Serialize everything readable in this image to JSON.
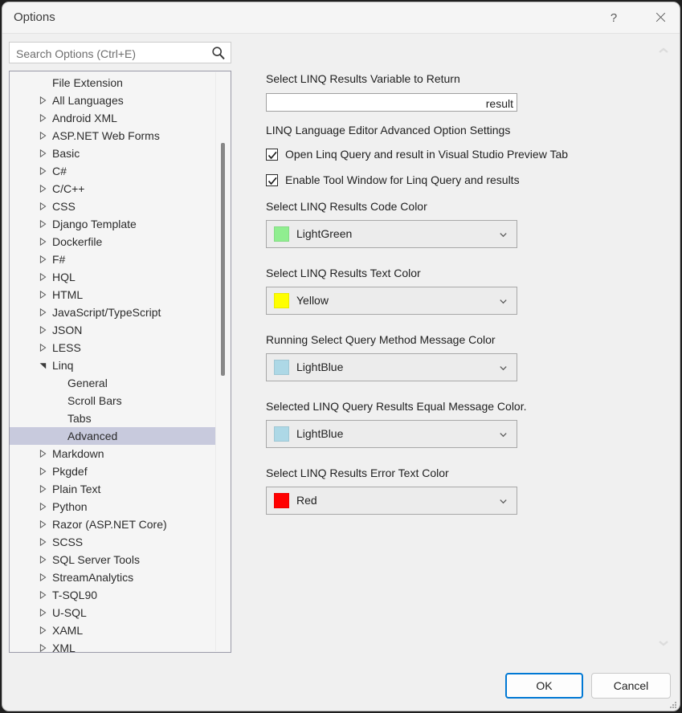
{
  "window": {
    "title": "Options",
    "help_icon": "question-mark-icon",
    "close_icon": "close-icon"
  },
  "search": {
    "placeholder": "Search Options (Ctrl+E)",
    "value": "",
    "icon": "search-icon"
  },
  "tree": {
    "items": [
      {
        "label": "File Extension",
        "level": 1,
        "arrow": "none",
        "selected": false
      },
      {
        "label": "All Languages",
        "level": 0,
        "arrow": "collapsed",
        "selected": false
      },
      {
        "label": "Android XML",
        "level": 0,
        "arrow": "collapsed",
        "selected": false
      },
      {
        "label": "ASP.NET Web Forms",
        "level": 0,
        "arrow": "collapsed",
        "selected": false
      },
      {
        "label": "Basic",
        "level": 0,
        "arrow": "collapsed",
        "selected": false
      },
      {
        "label": "C#",
        "level": 0,
        "arrow": "collapsed",
        "selected": false
      },
      {
        "label": "C/C++",
        "level": 0,
        "arrow": "collapsed",
        "selected": false
      },
      {
        "label": "CSS",
        "level": 0,
        "arrow": "collapsed",
        "selected": false
      },
      {
        "label": "Django Template",
        "level": 0,
        "arrow": "collapsed",
        "selected": false
      },
      {
        "label": "Dockerfile",
        "level": 0,
        "arrow": "collapsed",
        "selected": false
      },
      {
        "label": "F#",
        "level": 0,
        "arrow": "collapsed",
        "selected": false
      },
      {
        "label": "HQL",
        "level": 0,
        "arrow": "collapsed",
        "selected": false
      },
      {
        "label": "HTML",
        "level": 0,
        "arrow": "collapsed",
        "selected": false
      },
      {
        "label": "JavaScript/TypeScript",
        "level": 0,
        "arrow": "collapsed",
        "selected": false
      },
      {
        "label": "JSON",
        "level": 0,
        "arrow": "collapsed",
        "selected": false
      },
      {
        "label": "LESS",
        "level": 0,
        "arrow": "collapsed",
        "selected": false
      },
      {
        "label": "Linq",
        "level": 0,
        "arrow": "expanded",
        "selected": false
      },
      {
        "label": "General",
        "level": 2,
        "arrow": "none",
        "selected": false
      },
      {
        "label": "Scroll Bars",
        "level": 2,
        "arrow": "none",
        "selected": false
      },
      {
        "label": "Tabs",
        "level": 2,
        "arrow": "none",
        "selected": false
      },
      {
        "label": "Advanced",
        "level": 2,
        "arrow": "none",
        "selected": true
      },
      {
        "label": "Markdown",
        "level": 0,
        "arrow": "collapsed",
        "selected": false
      },
      {
        "label": "Pkgdef",
        "level": 0,
        "arrow": "collapsed",
        "selected": false
      },
      {
        "label": "Plain Text",
        "level": 0,
        "arrow": "collapsed",
        "selected": false
      },
      {
        "label": "Python",
        "level": 0,
        "arrow": "collapsed",
        "selected": false
      },
      {
        "label": "Razor (ASP.NET Core)",
        "level": 0,
        "arrow": "collapsed",
        "selected": false
      },
      {
        "label": "SCSS",
        "level": 0,
        "arrow": "collapsed",
        "selected": false
      },
      {
        "label": "SQL Server Tools",
        "level": 0,
        "arrow": "collapsed",
        "selected": false
      },
      {
        "label": "StreamAnalytics",
        "level": 0,
        "arrow": "collapsed",
        "selected": false
      },
      {
        "label": "T-SQL90",
        "level": 0,
        "arrow": "collapsed",
        "selected": false
      },
      {
        "label": "U-SQL",
        "level": 0,
        "arrow": "collapsed",
        "selected": false
      },
      {
        "label": "XAML",
        "level": 0,
        "arrow": "collapsed",
        "selected": false
      },
      {
        "label": "XML",
        "level": 0,
        "arrow": "collapsed",
        "selected": false
      }
    ]
  },
  "content": {
    "variable_label": "Select LINQ Results Variable to Return",
    "variable_value": "result",
    "variable_placeholder": "",
    "settings_header": "LINQ Language Editor Advanced Option Settings",
    "checkboxes": [
      {
        "label": "Open Linq Query and result in Visual Studio Preview Tab",
        "checked": true
      },
      {
        "label": "Enable Tool Window for Linq Query and results",
        "checked": true
      }
    ],
    "dropdowns": [
      {
        "label": "Select LINQ Results Code Color",
        "value": "LightGreen",
        "swatch": "#90ee90"
      },
      {
        "label": "Select LINQ Results Text Color",
        "value": "Yellow",
        "swatch": "#ffff00"
      },
      {
        "label": "Running Select Query Method Message Color",
        "value": "LightBlue",
        "swatch": "#add8e6"
      },
      {
        "label": "Selected LINQ Query Results Equal Message Color.",
        "value": "LightBlue",
        "swatch": "#add8e6"
      },
      {
        "label": "Select LINQ Results Error Text Color",
        "value": "Red",
        "swatch": "#ff0000"
      }
    ],
    "scroll_up_icon": "chevron-up-icon",
    "scroll_down_icon": "chevron-down-icon"
  },
  "footer": {
    "ok_label": "OK",
    "cancel_label": "Cancel"
  },
  "colors": {
    "accent": "#0078d4",
    "selection": "#c8cadd",
    "dialog_bg": "#f0f0f0"
  }
}
